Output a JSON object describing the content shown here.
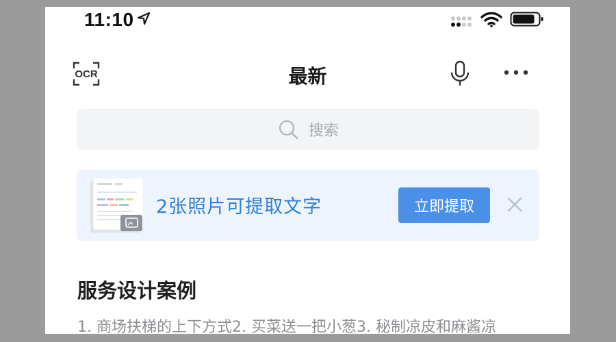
{
  "status_bar": {
    "time": "11:10"
  },
  "header": {
    "title": "最新",
    "icons": [
      "ocr-icon",
      "microphone-icon",
      "more-icon"
    ]
  },
  "search": {
    "placeholder": "搜索"
  },
  "banner": {
    "text": "2张照片可提取文字",
    "button_label": "立即提取",
    "accent_color": "#4a90e8",
    "text_color": "#2f7fd8",
    "background": "#edf4fd"
  },
  "notes": [
    {
      "title": "服务设计案例",
      "preview": "1. 商场扶梯的上下方式2. 买菜送一把小葱3. 秘制凉皮和麻酱凉"
    }
  ]
}
